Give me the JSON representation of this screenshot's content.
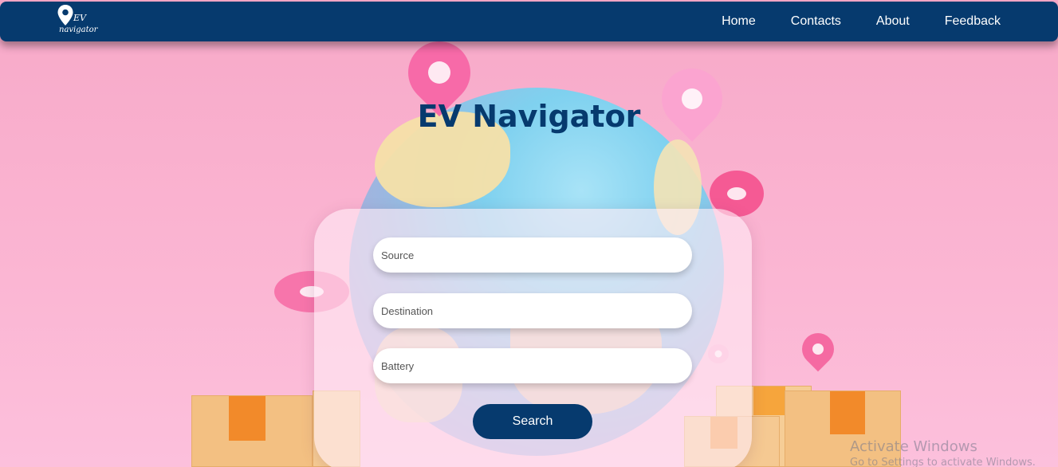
{
  "navbar": {
    "logo_text_line1": "EV",
    "logo_text_line2": "navigator",
    "links": [
      "Home",
      "Contacts",
      "About",
      "Feedback"
    ]
  },
  "hero": {
    "title": "EV Navigator"
  },
  "form": {
    "source_placeholder": "Source",
    "destination_placeholder": "Destination",
    "battery_placeholder": "Battery",
    "search_label": "Search"
  },
  "watermark": {
    "line1": "Activate Windows",
    "line2": "Go to Settings to activate Windows."
  },
  "colors": {
    "navbar": "#063a6e",
    "background": "#fbb6d3",
    "accent_button": "#063a6e",
    "title": "#063a6e"
  },
  "icons": {
    "logo": "map-pin-icon"
  }
}
